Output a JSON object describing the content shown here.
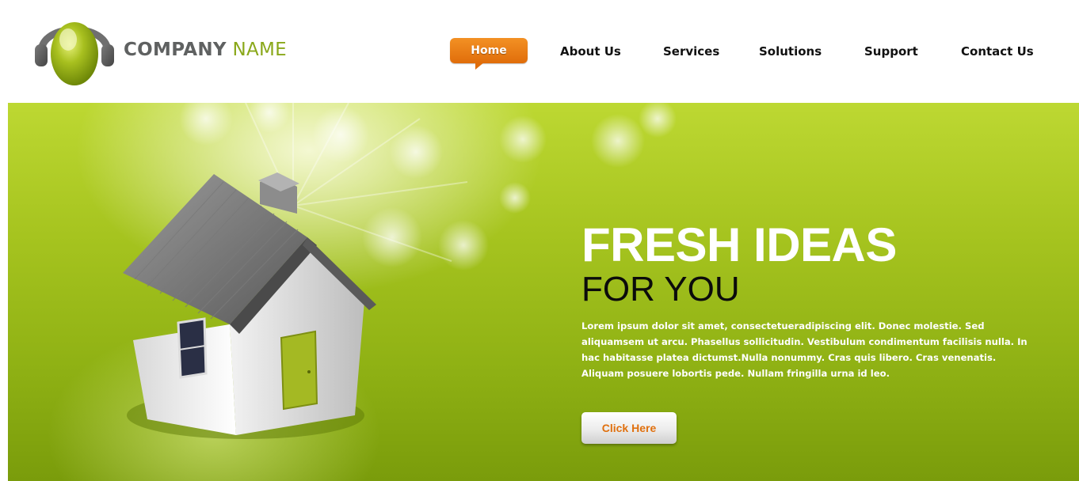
{
  "header": {
    "brand": {
      "part1": "COMPANY",
      "part2": "NAME",
      "logo_icon": "headphones-head-icon"
    },
    "nav": [
      {
        "label": "Home",
        "active": true
      },
      {
        "label": "About Us"
      },
      {
        "label": "Services"
      },
      {
        "label": "Solutions"
      },
      {
        "label": "Support"
      },
      {
        "label": "Contact Us"
      }
    ]
  },
  "hero": {
    "headline": "FRESH IDEAS",
    "subline": "FOR YOU",
    "body": "Lorem ipsum dolor sit amet, consectetueradipiscing elit. Donec molestie. Sed aliquamsem ut arcu. Phasellus sollicitudin. Vestibulum condimentum facilisis nulla. In hac habitasse platea dictumst.Nulla nonummy. Cras quis libero. Cras venenatis. Aliquam posuere lobortis pede. Nullam fringilla urna id leo.",
    "cta_label": "Click Here",
    "illustration": "house-icon"
  },
  "colors": {
    "accent_orange": "#e87a12",
    "brand_green": "#8aa81a",
    "hero_green": "#9dbc1a",
    "text_dark": "#111111"
  }
}
